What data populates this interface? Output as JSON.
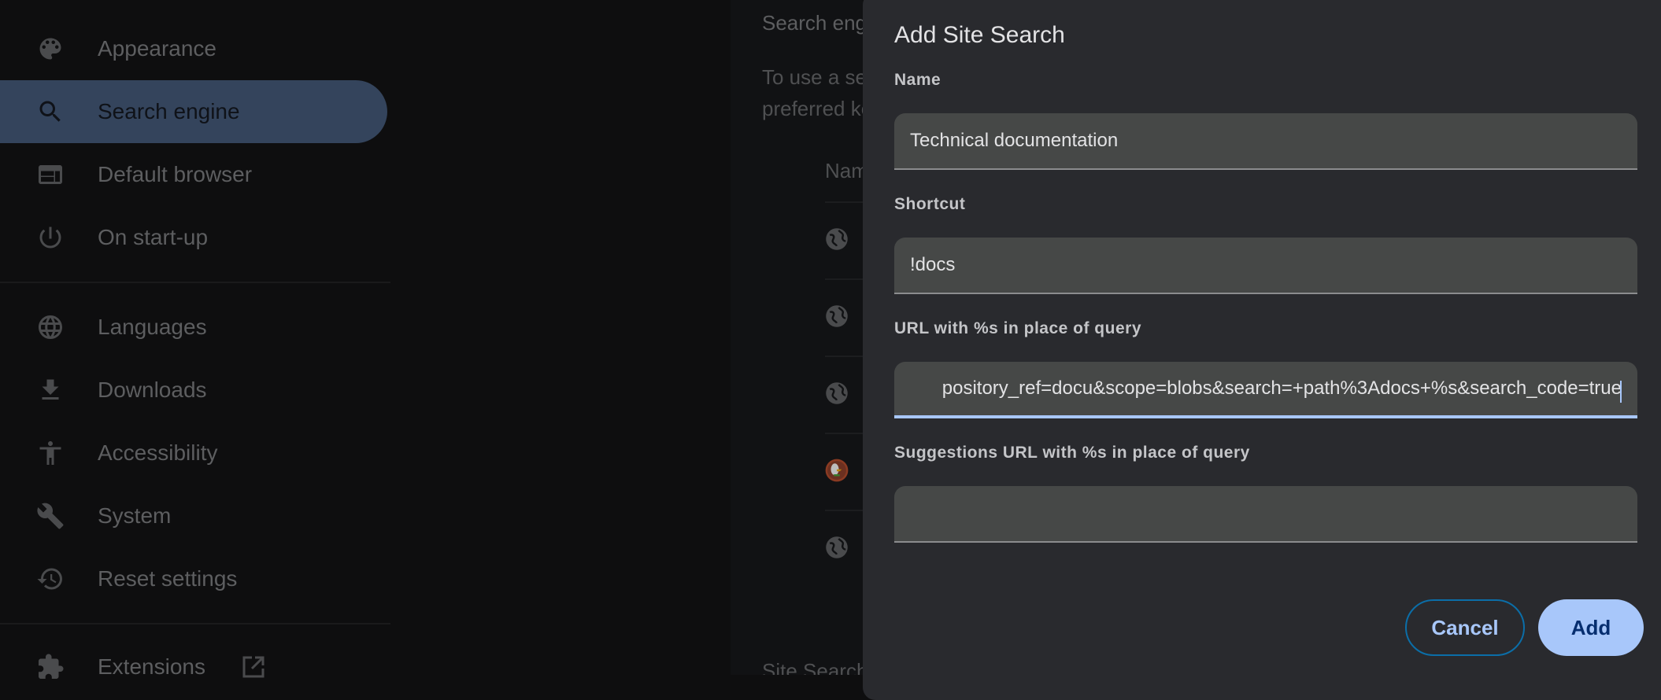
{
  "sidebar": {
    "items": [
      {
        "label": "Appearance",
        "icon": "palette-icon",
        "active": false
      },
      {
        "label": "Search engine",
        "icon": "search-icon",
        "active": true
      },
      {
        "label": "Default browser",
        "icon": "browser-window-icon",
        "active": false
      },
      {
        "label": "On start-up",
        "icon": "power-icon",
        "active": false
      },
      {
        "label": "Languages",
        "icon": "globe-icon",
        "active": false
      },
      {
        "label": "Downloads",
        "icon": "download-icon",
        "active": false
      },
      {
        "label": "Accessibility",
        "icon": "accessibility-icon",
        "active": false
      },
      {
        "label": "System",
        "icon": "wrench-icon",
        "active": false
      },
      {
        "label": "Reset settings",
        "icon": "history-icon",
        "active": false
      },
      {
        "label": "Extensions",
        "icon": "puzzle-icon",
        "active": false,
        "external": "open-in-new-icon"
      }
    ]
  },
  "main": {
    "section_title": "Search engine",
    "description_line1": "To use a search engine other than the default, type its shortcut in the address bar followed by your",
    "description_line2": "preferred keyword",
    "column_header": "Name",
    "rows": [
      {
        "icon": "globe-icon"
      },
      {
        "icon": "globe-icon"
      },
      {
        "icon": "globe-icon"
      },
      {
        "icon": "duckduckgo-icon"
      },
      {
        "icon": "globe-icon"
      }
    ],
    "site_search_title": "Site Search"
  },
  "dialog": {
    "title": "Add Site Search",
    "fields": {
      "name": {
        "label": "Name",
        "value": "Technical documentation"
      },
      "shortcut": {
        "label": "Shortcut",
        "value": "!docs"
      },
      "url": {
        "label": "URL with %s in place of query",
        "value": "pository_ref=docu&scope=blobs&search=+path%3Adocs+%s&search_code=true"
      },
      "suggestions_url": {
        "label": "Suggestions URL with %s in place of query",
        "value": ""
      }
    },
    "buttons": {
      "cancel": "Cancel",
      "add": "Add"
    }
  },
  "colors": {
    "accent": "#a8c7fa",
    "active_nav_bg": "#34445c",
    "dialog_bg": "#292a2e",
    "field_bg": "#464847",
    "add_button_text": "#062e6f"
  }
}
